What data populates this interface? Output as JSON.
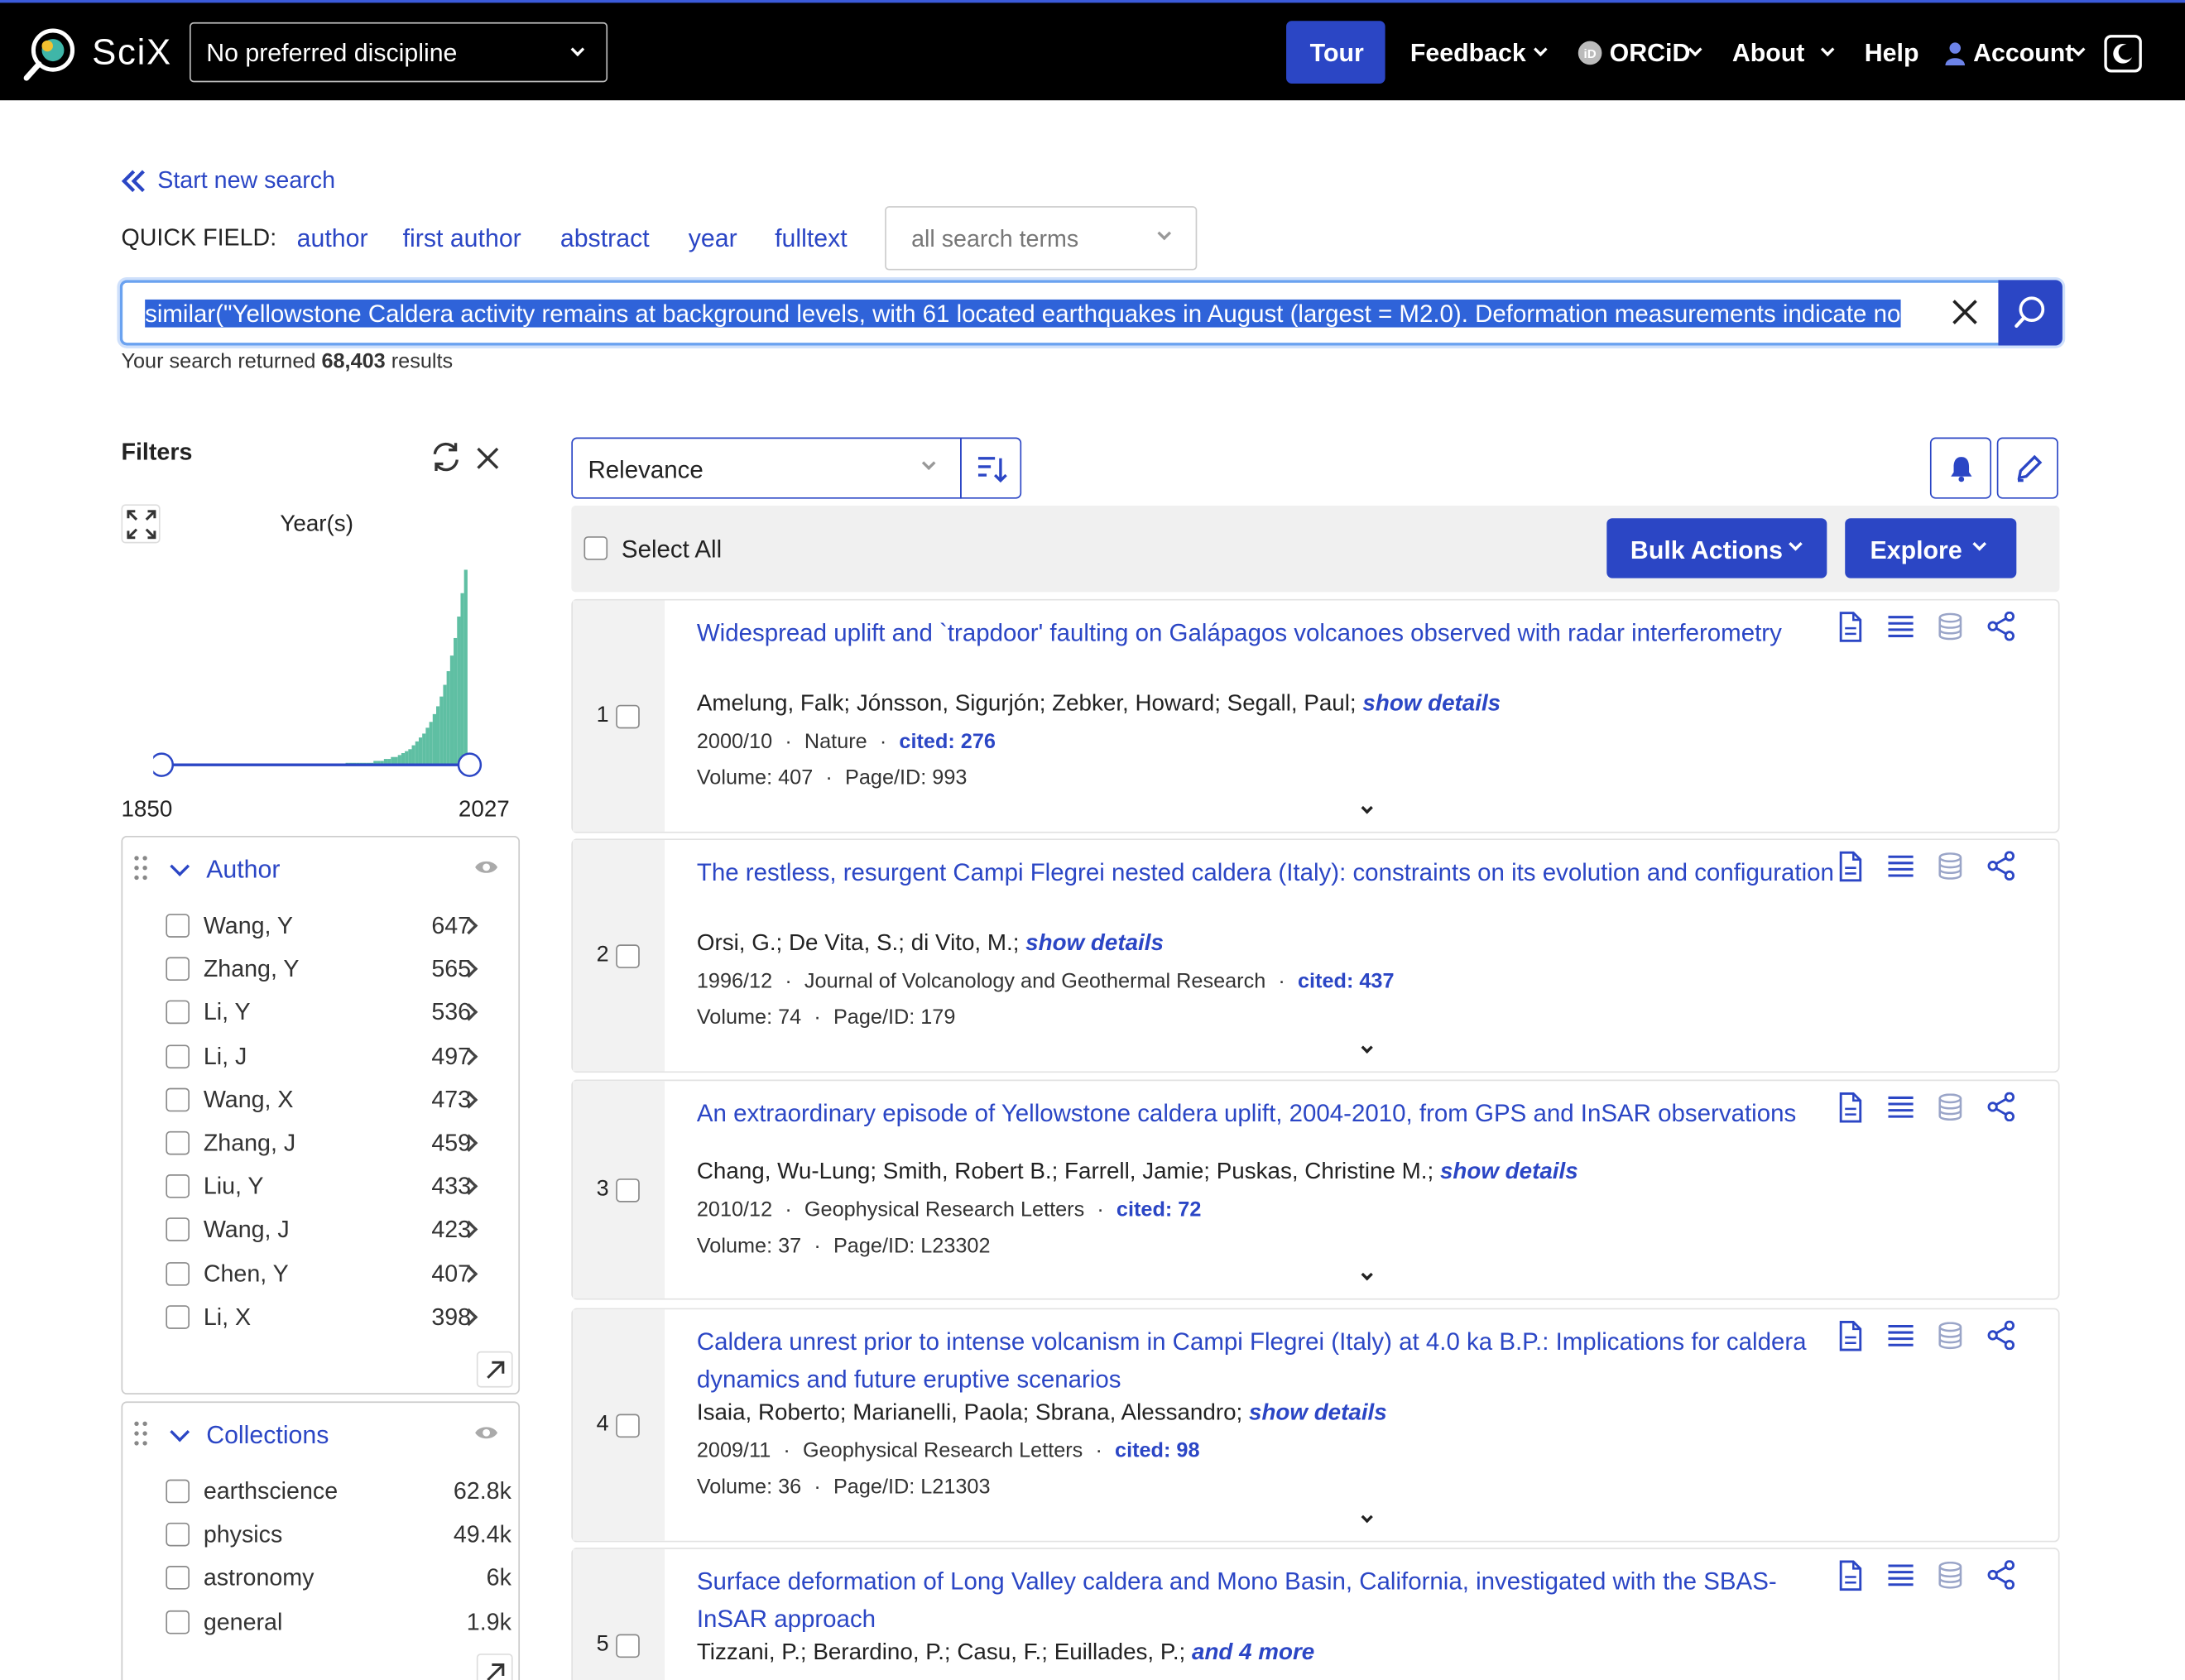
{
  "header": {
    "logo_text": "SciX",
    "discipline": "No preferred discipline",
    "tour": "Tour",
    "feedback": "Feedback",
    "orcid": "ORCiD",
    "about": "About",
    "help": "Help",
    "account": "Account"
  },
  "search": {
    "start_new": "Start new search",
    "quick_field_label": "QUICK FIELD:",
    "quick_fields": [
      "author",
      "first author",
      "abstract",
      "year",
      "fulltext"
    ],
    "terms_select": "all search terms",
    "query": "similar(\"Yellowstone Caldera activity remains at background levels, with 61 located earthquakes in August (largest = M2.0). Deformation measurements indicate no",
    "results_prefix": "Your search returned",
    "results_count": "68,403",
    "results_suffix": "results"
  },
  "filters": {
    "title": "Filters",
    "year_title": "Year(s)",
    "year_min": "1850",
    "year_max": "2027",
    "histogram": [
      1,
      1,
      1,
      1,
      1,
      1,
      1,
      1,
      2,
      2,
      2,
      3,
      3,
      4,
      4,
      5,
      6,
      7,
      8,
      10,
      12,
      14,
      16,
      19,
      22,
      26,
      30,
      35,
      41,
      48,
      56,
      65,
      76,
      88,
      100
    ],
    "author": {
      "title": "Author",
      "items": [
        {
          "name": "Wang, Y",
          "count": "647"
        },
        {
          "name": "Zhang, Y",
          "count": "565"
        },
        {
          "name": "Li, Y",
          "count": "536"
        },
        {
          "name": "Li, J",
          "count": "497"
        },
        {
          "name": "Wang, X",
          "count": "473"
        },
        {
          "name": "Zhang, J",
          "count": "459"
        },
        {
          "name": "Liu, Y",
          "count": "433"
        },
        {
          "name": "Wang, J",
          "count": "423"
        },
        {
          "name": "Chen, Y",
          "count": "407"
        },
        {
          "name": "Li, X",
          "count": "398"
        }
      ]
    },
    "collections": {
      "title": "Collections",
      "items": [
        {
          "name": "earthscience",
          "count": "62.8k"
        },
        {
          "name": "physics",
          "count": "49.4k"
        },
        {
          "name": "astronomy",
          "count": "6k"
        },
        {
          "name": "general",
          "count": "1.9k"
        }
      ]
    }
  },
  "toolbar": {
    "sort": "Relevance",
    "select_all": "Select All",
    "bulk_actions": "Bulk Actions",
    "explore": "Explore"
  },
  "results": [
    {
      "index": "1",
      "title": "Widespread uplift and `trapdoor' faulting on Galápagos volcanoes observed with radar interferometry",
      "authors": "Amelung, Falk; Jónsson, Sigurjón; Zebker, Howard; Segall, Paul;",
      "more": "show details",
      "date": "2000/10",
      "journal": "Nature",
      "cited": "cited: 276",
      "volume": "Volume: 407",
      "page": "Page/ID: 993"
    },
    {
      "index": "2",
      "title": "The restless, resurgent Campi Flegrei nested caldera (Italy): constraints on its evolution and configuration",
      "authors": "Orsi, G.; De Vita, S.; di Vito, M.;",
      "more": "show details",
      "date": "1996/12",
      "journal": "Journal of Volcanology and Geothermal Research",
      "cited": "cited: 437",
      "volume": "Volume: 74",
      "page": "Page/ID: 179"
    },
    {
      "index": "3",
      "title": "An extraordinary episode of Yellowstone caldera uplift, 2004-2010, from GPS and InSAR observations",
      "authors": "Chang, Wu-Lung; Smith, Robert B.; Farrell, Jamie; Puskas, Christine M.;",
      "more": "show details",
      "date": "2010/12",
      "journal": "Geophysical Research Letters",
      "cited": "cited: 72",
      "volume": "Volume: 37",
      "page": "Page/ID: L23302"
    },
    {
      "index": "4",
      "title": "Caldera unrest prior to intense volcanism in Campi Flegrei (Italy) at 4.0 ka B.P.: Implications for caldera dynamics and future eruptive scenarios",
      "authors": "Isaia, Roberto; Marianelli, Paola; Sbrana, Alessandro;",
      "more": "show details",
      "date": "2009/11",
      "journal": "Geophysical Research Letters",
      "cited": "cited: 98",
      "volume": "Volume: 36",
      "page": "Page/ID: L21303"
    },
    {
      "index": "5",
      "title": "Surface deformation of Long Valley caldera and Mono Basin, California, investigated with the SBAS-InSAR approach",
      "authors": "Tizzani, P.; Berardino, P.; Casu, F.; Euillades, P.;",
      "more": "and 4 more"
    }
  ]
}
